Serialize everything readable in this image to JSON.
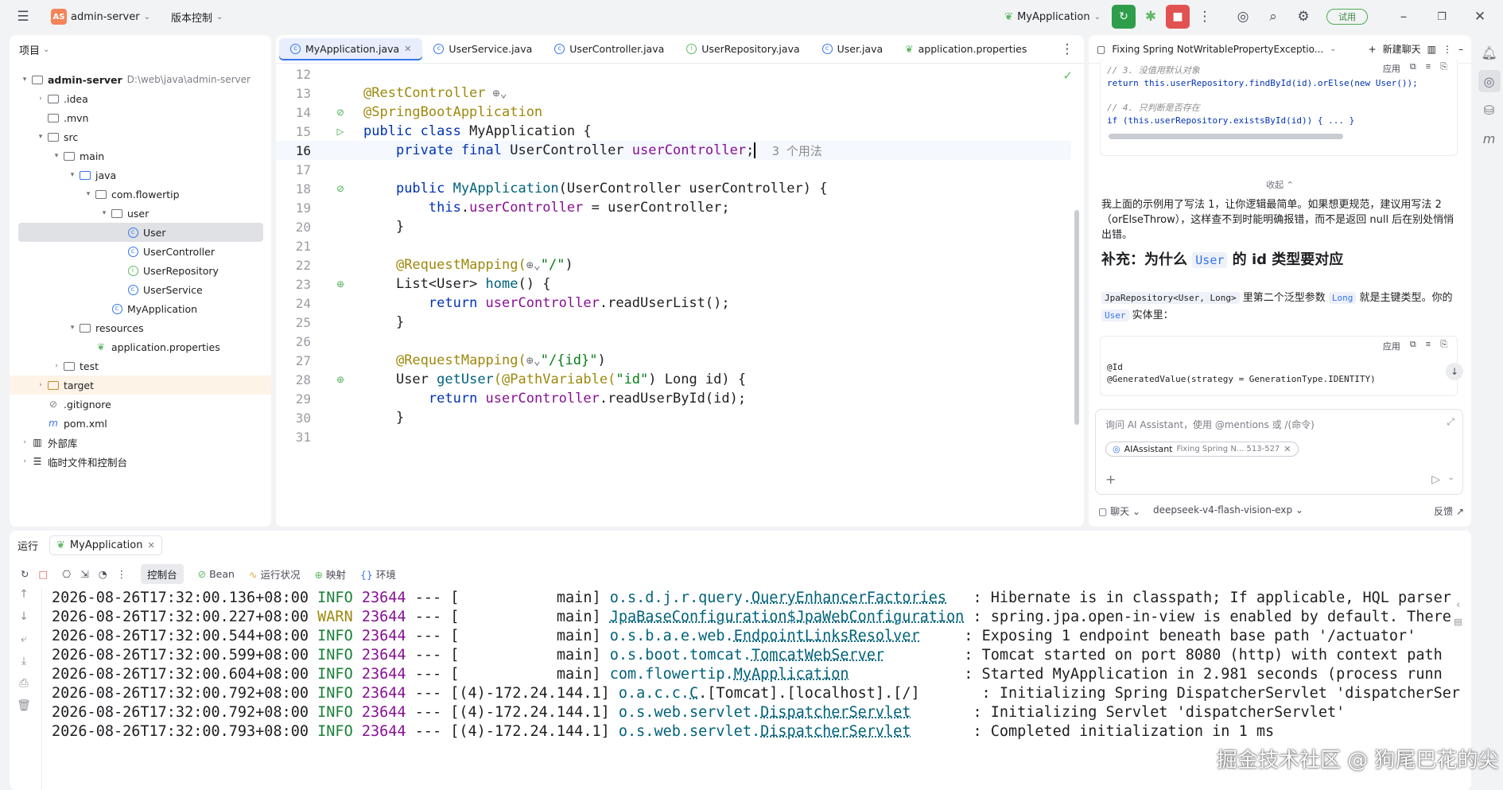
{
  "titlebar": {
    "project_badge": "AS",
    "project_name": "admin-server",
    "vcs_label": "版本控制",
    "run_config": "MyApplication",
    "trial_label": "试用"
  },
  "project_panel": {
    "title": "项目",
    "tree": [
      {
        "label": "admin-server",
        "path": "D:\\web\\java\\admin-server",
        "bold": true
      },
      {
        "label": ".idea"
      },
      {
        "label": ".mvn"
      },
      {
        "label": "src"
      },
      {
        "label": "main"
      },
      {
        "label": "java"
      },
      {
        "label": "com.flowertip"
      },
      {
        "label": "user"
      },
      {
        "label": "User"
      },
      {
        "label": "UserController"
      },
      {
        "label": "UserRepository"
      },
      {
        "label": "UserService"
      },
      {
        "label": "MyApplication"
      },
      {
        "label": "resources"
      },
      {
        "label": "application.properties"
      },
      {
        "label": "test"
      },
      {
        "label": "target"
      },
      {
        "label": ".gitignore"
      },
      {
        "label": "pom.xml"
      },
      {
        "label": "外部库"
      },
      {
        "label": "临时文件和控制台"
      }
    ]
  },
  "editor": {
    "tabs": [
      {
        "label": "MyApplication.java",
        "active": true
      },
      {
        "label": "UserService.java"
      },
      {
        "label": "UserController.java"
      },
      {
        "label": "UserRepository.java"
      },
      {
        "label": "User.java"
      },
      {
        "label": "application.properties"
      }
    ],
    "line_numbers": [
      "12",
      "13",
      "14",
      "15",
      "16",
      "17",
      "18",
      "19",
      "20",
      "21",
      "22",
      "23",
      "24",
      "25",
      "26",
      "27",
      "28",
      "29",
      "30",
      "31"
    ],
    "code": {
      "l13": "@RestController",
      "l14": "@SpringBootApplication",
      "l15_kw": "public class ",
      "l15_name": "MyApplication {",
      "l16_kw": "private final ",
      "l16_type": "UserController ",
      "l16_field": "userController",
      "l16_semi": ";",
      "l16_hint": "3 个用法",
      "l18_kw": "public ",
      "l18_fn": "MyApplication",
      "l18_rest": "(UserController userController) {",
      "l19_this": "this",
      "l19_dot": ".",
      "l19_field": "userController",
      "l19_rest": " = userController;",
      "close": "}",
      "l22_an": "@RequestMapping(",
      "l22_str": "\"/\"",
      "l22_end": ")",
      "l23_type": "List<User> ",
      "l23_fn": "home",
      "l23_rest": "() {",
      "ret": "return ",
      "l24_field": "userController",
      "l24_rest": ".readUserList();",
      "l27_an": "@RequestMapping(",
      "l27_str": "\"/{id}\"",
      "l27_end": ")",
      "l28_type": "User ",
      "l28_fn": "getUser",
      "l28_an": "(@PathVariable(",
      "l28_str": "\"id\"",
      "l28_rest": ") Long id) {",
      "l29_field": "userController",
      "l29_rest": ".readUserById(id);"
    }
  },
  "ai_panel": {
    "chat_title": "Fixing Spring NotWritablePropertyExceptio...",
    "new_chat": "新建聊天",
    "apply_label": "应用",
    "code1_comment1": "// 3. 没值用默认对象",
    "code1_line1": "return this.userRepository.findById(id).orElse(new User());",
    "code1_comment2": "// 4. 只判断是否存在",
    "code1_line2": "if (this.userRepository.existsById(id)) { ... }",
    "collapse": "收起",
    "paragraph": "我上面的示例用了写法 1，让你逻辑最简单。如果想更规范，建议用写法 2（orElseThrow），这样查不到时能明确报错，而不是返回 null 后在别处悄悄出错。",
    "heading_pre": "补充：为什么 ",
    "heading_code": "User",
    "heading_post": " 的 id 类型要对应",
    "p2_code1": "JpaRepository<User, Long>",
    "p2_mid": " 里第二个泛型参数 ",
    "p2_code2": "Long",
    "p2_post": " 就是主键类型。你的 ",
    "p2_code3": "User",
    "p2_end": " 实体里：",
    "code2_line1": "@Id",
    "code2_line2": "@GeneratedValue(strategy = GenerationType.IDENTITY)",
    "input_placeholder": "询问 AI Assistant，使用 @mentions 或 /(命令)",
    "chip_label": "AIAssistant",
    "chip_detail": "Fixing Spring N... 513-527",
    "mode": "聊天",
    "model": "deepseek-v4-flash-vision-exp",
    "feedback": "反馈"
  },
  "run_panel": {
    "title": "运行",
    "run_tab": "MyApplication",
    "tools": [
      "控制台",
      "Bean",
      "运行状况",
      "映射",
      "环境"
    ],
    "logs": [
      {
        "ts": "2026-08-26T17:32:00.136+08:00",
        "lvl": "INFO",
        "pid": "23644",
        "sep": " --- [",
        "thread": "           main]",
        "logger_pre": "o.s.d.j.r.query.",
        "logger_u": "QueryEnhancerFactories",
        "pad": "   ",
        "msg": ": Hibernate is in classpath; If applicable, HQL parser"
      },
      {
        "ts": "2026-08-26T17:32:00.227+08:00",
        "lvl": "WARN",
        "pid": "23644",
        "sep": " --- [",
        "thread": "           main]",
        "logger_pre": "",
        "logger_u": "JpaBaseConfiguration$JpaWebConfiguration",
        "pad": " ",
        "msg": ": spring.jpa.open-in-view is enabled by default. There"
      },
      {
        "ts": "2026-08-26T17:32:00.544+08:00",
        "lvl": "INFO",
        "pid": "23644",
        "sep": " --- [",
        "thread": "           main]",
        "logger_pre": "o.s.b.a.e.web.",
        "logger_u": "EndpointLinksResolver",
        "pad": "     ",
        "msg": ": Exposing 1 endpoint beneath base path '/actuator'"
      },
      {
        "ts": "2026-08-26T17:32:00.599+08:00",
        "lvl": "INFO",
        "pid": "23644",
        "sep": " --- [",
        "thread": "           main]",
        "logger_pre": "o.s.boot.tomcat.",
        "logger_u": "TomcatWebServer",
        "pad": "         ",
        "msg": ": Tomcat started on port 8080 (http) with context path"
      },
      {
        "ts": "2026-08-26T17:32:00.604+08:00",
        "lvl": "INFO",
        "pid": "23644",
        "sep": " --- [",
        "thread": "           main]",
        "logger_pre": "com.flowertip.",
        "logger_u": "MyApplication",
        "pad": "             ",
        "msg": ": Started MyApplication in 2.981 seconds (process runn"
      },
      {
        "ts": "2026-08-26T17:32:00.792+08:00",
        "lvl": "INFO",
        "pid": "23644",
        "sep": " --- [",
        "thread": "(4)-172.24.144.1]",
        "logger_pre": "o.a.c.c.",
        "logger_u": "C",
        "pad": "",
        "msg": ".[Tomcat].[localhost].[/]       : Initializing Spring DispatcherServlet 'dispatcherSer"
      },
      {
        "ts": "2026-08-26T17:32:00.792+08:00",
        "lvl": "INFO",
        "pid": "23644",
        "sep": " --- [",
        "thread": "(4)-172.24.144.1]",
        "logger_pre": "o.s.web.servlet.",
        "logger_u": "DispatcherServlet",
        "pad": "       ",
        "msg": ": Initializing Servlet 'dispatcherServlet'"
      },
      {
        "ts": "2026-08-26T17:32:00.793+08:00",
        "lvl": "INFO",
        "pid": "23644",
        "sep": " --- [",
        "thread": "(4)-172.24.144.1]",
        "logger_pre": "o.s.web.servlet.",
        "logger_u": "DispatcherServlet",
        "pad": "       ",
        "msg": ": Completed initialization in 1 ms"
      }
    ]
  },
  "watermark": "掘金技术社区 @ 狗尾巴花的尖",
  "colors": {
    "accent": "#3574f0",
    "run_green": "#2e9e4a",
    "stop_red": "#e35252"
  }
}
